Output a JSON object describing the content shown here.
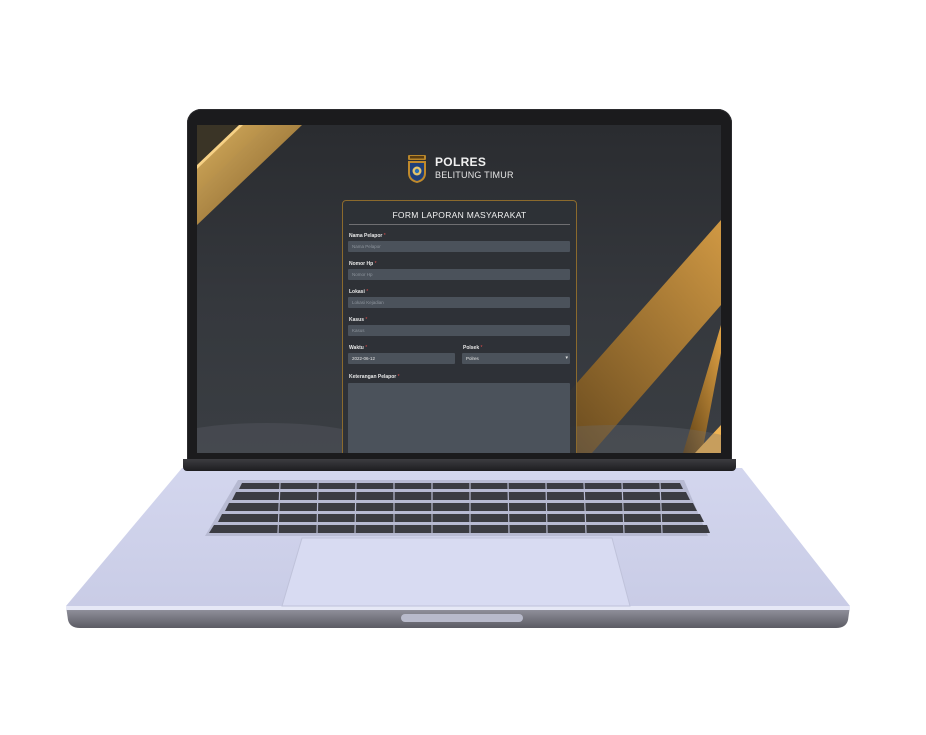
{
  "brand": {
    "title": "POLRES",
    "subtitle": "BELITUNG TIMUR"
  },
  "form": {
    "title": "FORM LAPORAN MASYARAKAT",
    "fields": {
      "nama_pelapor": {
        "label": "Nama Pelapor",
        "placeholder": "Nama Pelapor"
      },
      "nomor_hp": {
        "label": "Nomor Hp",
        "placeholder": "Nomor Hp"
      },
      "lokasi": {
        "label": "Lokasi",
        "placeholder": "Lokasi Kejadian"
      },
      "kasus": {
        "label": "Kasus",
        "placeholder": "Kasus"
      },
      "waktu": {
        "label": "Waktu",
        "value": "2022-06-12"
      },
      "polsek": {
        "label": "Polsek",
        "value": "Polres"
      },
      "keterangan": {
        "label": "Keterangan Pelapor"
      }
    },
    "required_mark": "*"
  },
  "colors": {
    "accent_gold": "#c8902e",
    "screen_bg": "#2f3237",
    "input_bg": "#4b525b",
    "required": "#e14b4b",
    "laptop_silver": "#d9dcf0"
  },
  "icons": {
    "logo": "police-shield-emblem",
    "dropdown": "chevron-down-icon"
  }
}
